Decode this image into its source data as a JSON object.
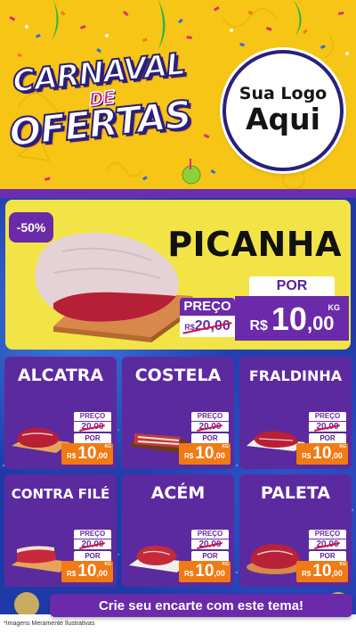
{
  "header": {
    "title_line1": "CARNAVAL",
    "title_line2": "DE",
    "title_line3": "OFERTAS",
    "logo_line1": "Sua Logo",
    "logo_line2": "Aqui"
  },
  "featured": {
    "discount": "-50%",
    "name": "PICANHA",
    "preco_label": "PREÇO",
    "old_currency": "R$",
    "old_price": "20,00",
    "por_label": "POR",
    "currency": "R$",
    "price_int": "10",
    "price_dec": ",00",
    "unit": "KG"
  },
  "products": [
    {
      "name": "ALCATRA",
      "preco_label": "PREÇO",
      "old_price": "20,00",
      "por_label": "POR",
      "currency": "R$",
      "price_int": "10",
      "price_dec": ",00",
      "unit": "KG"
    },
    {
      "name": "COSTELA",
      "preco_label": "PREÇO",
      "old_price": "20,00",
      "por_label": "POR",
      "currency": "R$",
      "price_int": "10",
      "price_dec": ",00",
      "unit": "KG"
    },
    {
      "name": "FRALDINHA",
      "preco_label": "PREÇO",
      "old_price": "20,00",
      "por_label": "POR",
      "currency": "R$",
      "price_int": "10",
      "price_dec": ",00",
      "unit": "KG"
    },
    {
      "name": "CONTRA FILÉ",
      "preco_label": "PREÇO",
      "old_price": "20,00",
      "por_label": "POR",
      "currency": "R$",
      "price_int": "10",
      "price_dec": ",00",
      "unit": "KG"
    },
    {
      "name": "ACÉM",
      "preco_label": "PREÇO",
      "old_price": "20,00",
      "por_label": "POR",
      "currency": "R$",
      "price_int": "10",
      "price_dec": ",00",
      "unit": "KG"
    },
    {
      "name": "PALETA",
      "preco_label": "PREÇO",
      "old_price": "20,00",
      "por_label": "POR",
      "currency": "R$",
      "price_int": "10",
      "price_dec": ",00",
      "unit": "KG"
    }
  ],
  "footer": {
    "cta": "Crie seu encarte com este tema!",
    "disclaimer": "*Imagens Meramente Ilustrativas"
  },
  "colors": {
    "header_yellow": "#f6c515",
    "purple": "#6a2aa9",
    "card_purple": "#5c2a9f",
    "glitter_blue": "#1f3aa8",
    "featured_yellow": "#f2e447",
    "price_orange": "#f07a14"
  }
}
